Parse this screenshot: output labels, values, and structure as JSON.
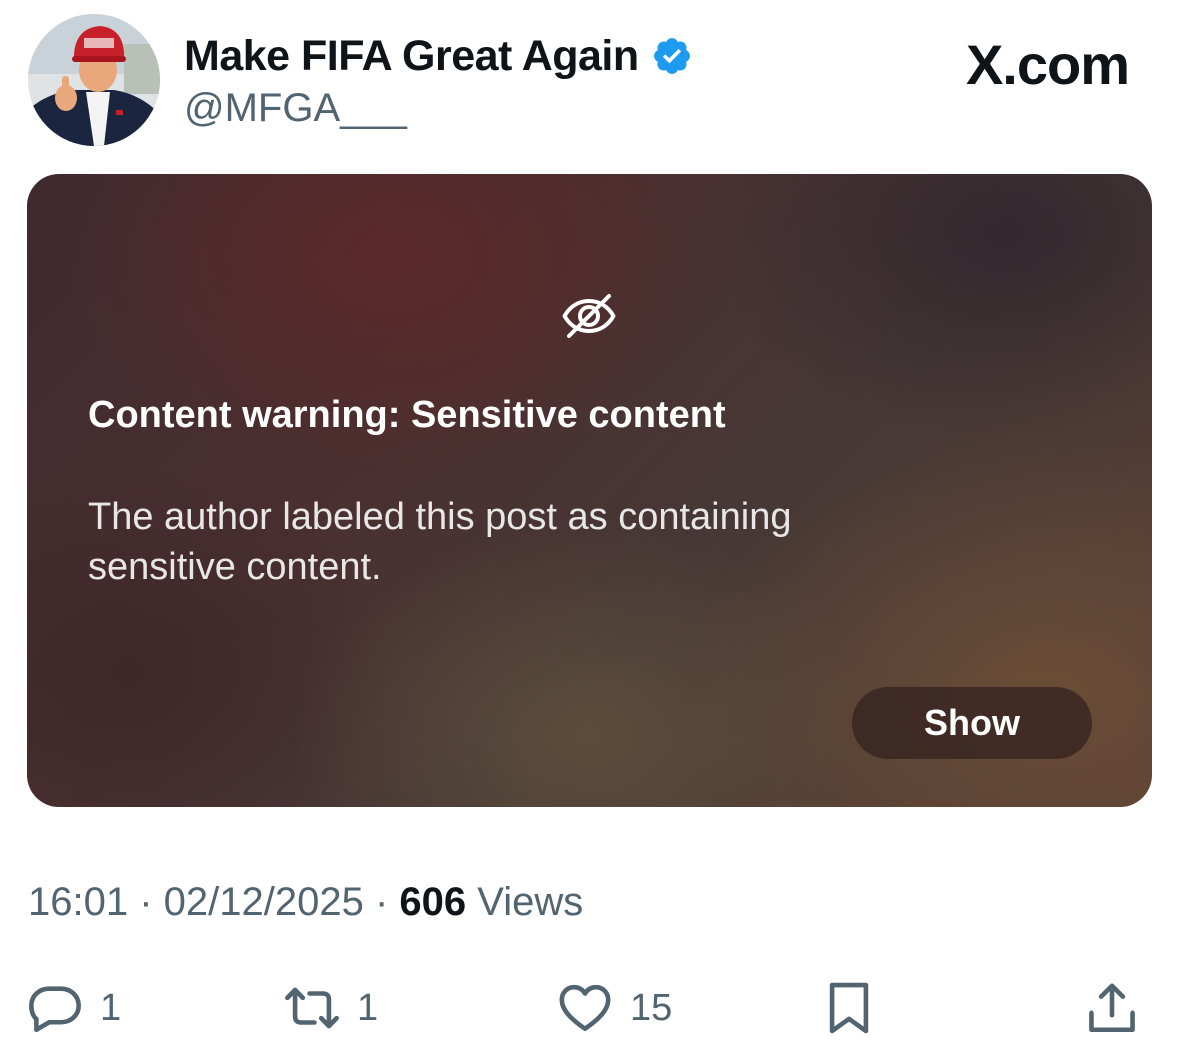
{
  "author": {
    "display_name": "Make FIFA Great Again",
    "handle": "@MFGA___",
    "verified": true,
    "verified_color": "#1d9bf0"
  },
  "site_label": "X.com",
  "warning": {
    "icon": "eye-off-icon",
    "title": "Content warning: Sensitive content",
    "description": "The author labeled this post as containing sensitive content.",
    "button_label": "Show"
  },
  "meta": {
    "time": "16:01",
    "separator": " · ",
    "date": "02/12/2025",
    "views_count": "606",
    "views_label": " Views"
  },
  "actions": {
    "reply": {
      "icon": "reply-icon",
      "count": "1"
    },
    "repost": {
      "icon": "repost-icon",
      "count": "1"
    },
    "like": {
      "icon": "heart-icon",
      "count": "15"
    },
    "bookmark": {
      "icon": "bookmark-icon"
    },
    "share": {
      "icon": "share-icon"
    }
  },
  "colors": {
    "text_primary": "#0f1419",
    "text_secondary": "#536471"
  }
}
